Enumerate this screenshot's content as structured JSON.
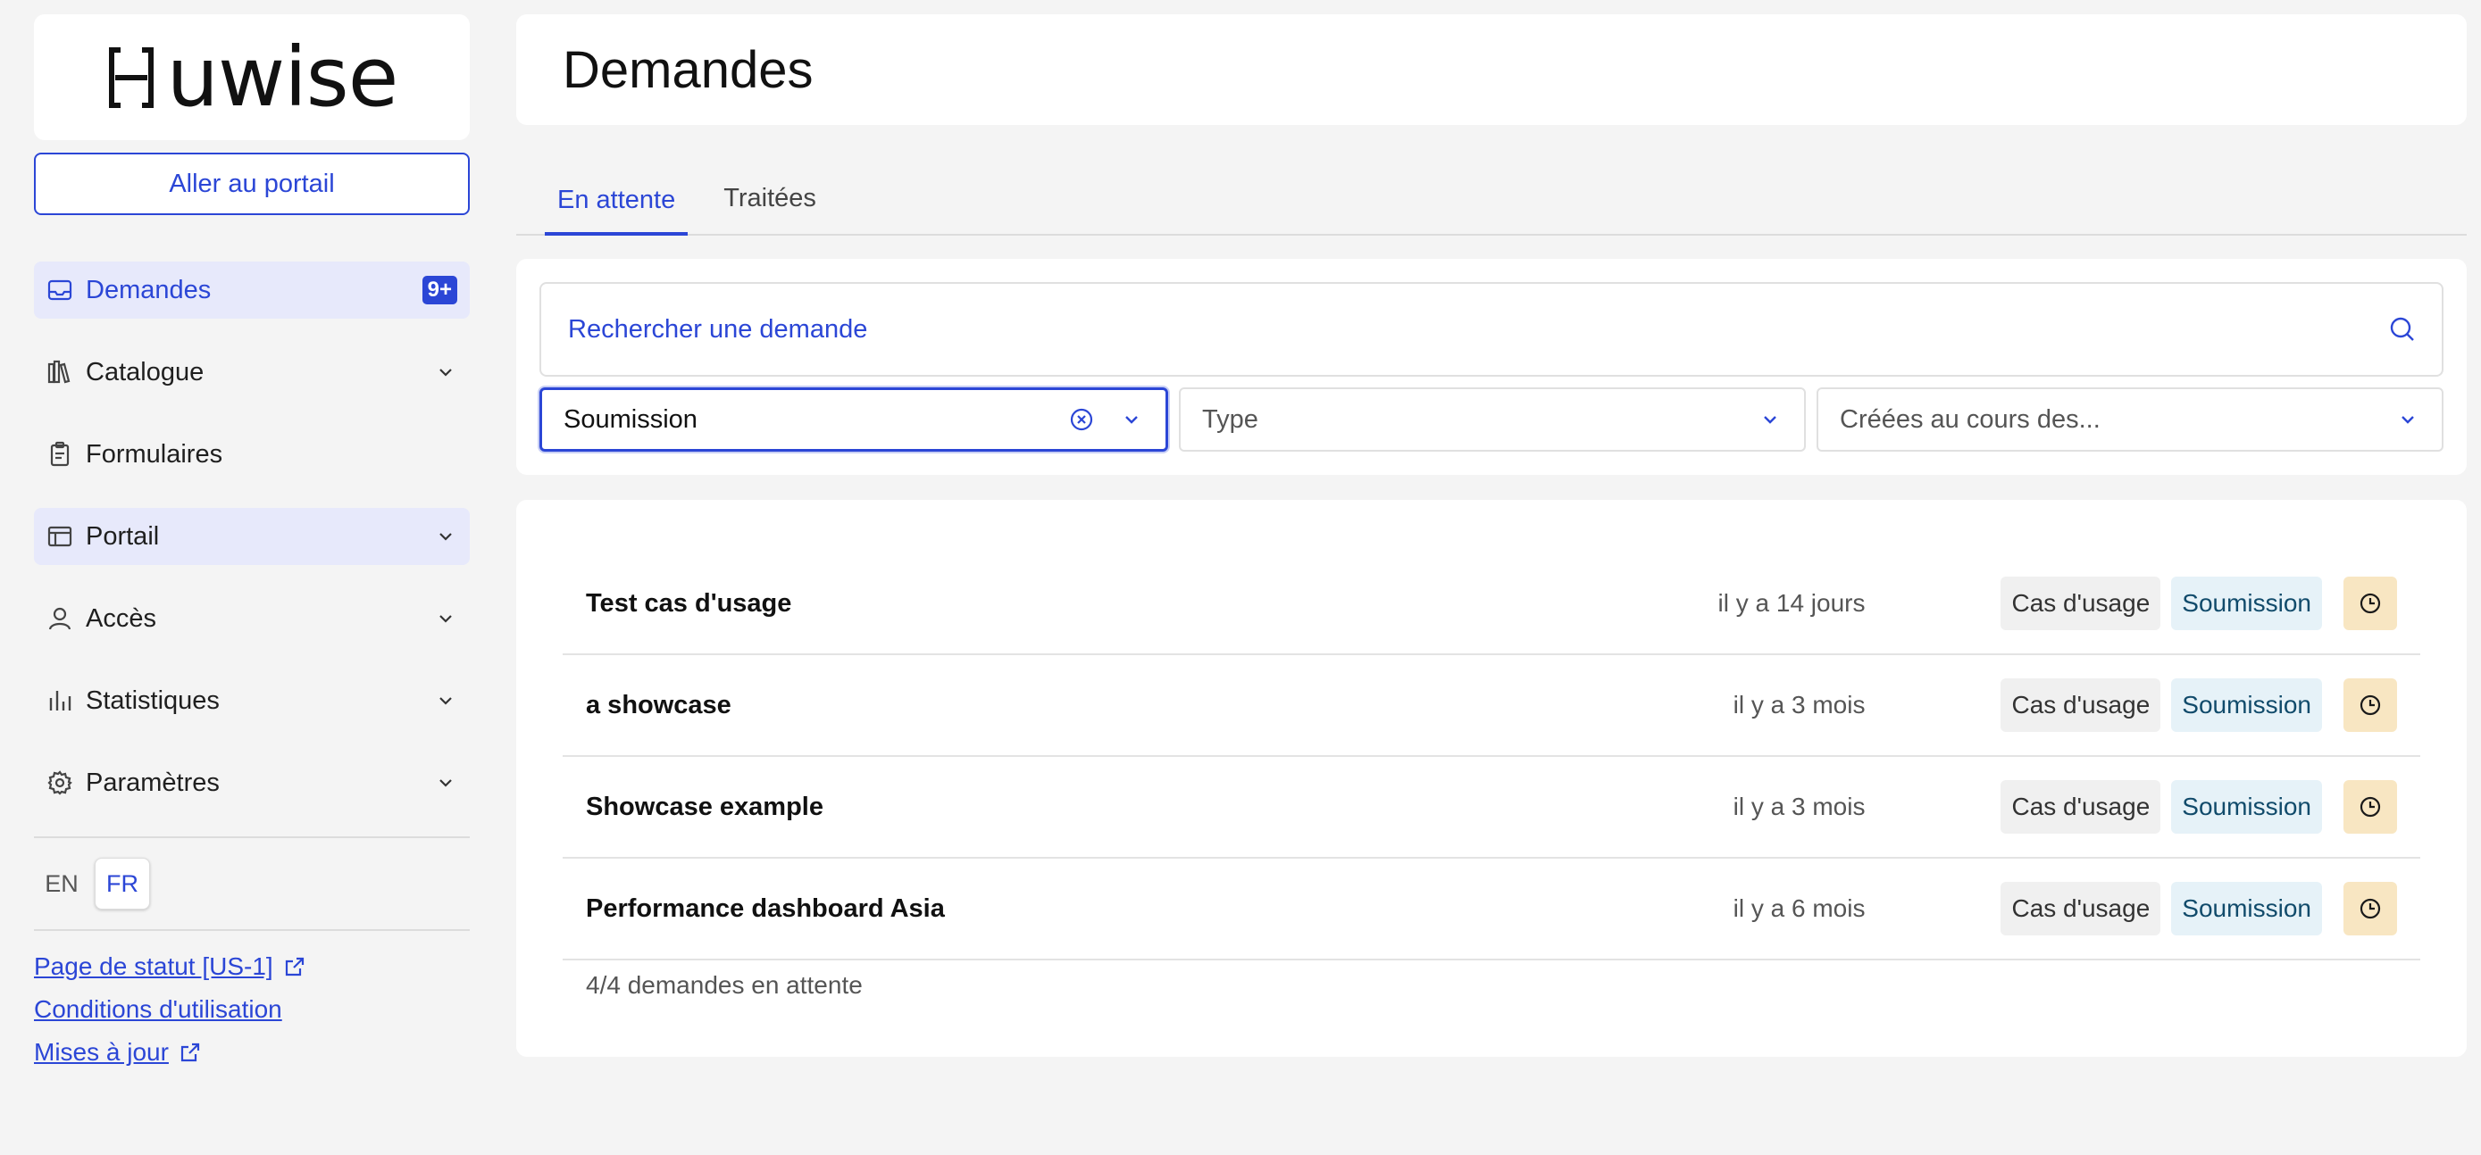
{
  "brand": {
    "logo_text": "uwise"
  },
  "sidebar": {
    "portal_button": "Aller au portail",
    "items": [
      {
        "label": "Demandes",
        "icon": "inbox-icon",
        "badge": "9+",
        "active": true
      },
      {
        "label": "Catalogue",
        "icon": "books-icon",
        "expandable": true
      },
      {
        "label": "Formulaires",
        "icon": "clipboard-icon"
      },
      {
        "label": "Portail",
        "icon": "browser-window-icon",
        "expandable": true,
        "highlighted": true
      },
      {
        "label": "Accès",
        "icon": "user-icon",
        "expandable": true
      },
      {
        "label": "Statistiques",
        "icon": "bar-chart-icon",
        "expandable": true
      },
      {
        "label": "Paramètres",
        "icon": "gear-icon",
        "expandable": true
      }
    ],
    "languages": [
      {
        "code": "EN",
        "active": false
      },
      {
        "code": "FR",
        "active": true
      }
    ],
    "footer_links": [
      {
        "label": "Page de statut [US-1]",
        "external": true
      },
      {
        "label": "Conditions d'utilisation",
        "external": false
      },
      {
        "label": "Mises à jour",
        "external": true
      }
    ]
  },
  "main": {
    "title": "Demandes",
    "tabs": [
      {
        "label": "En attente",
        "active": true
      },
      {
        "label": "Traitées",
        "active": false
      }
    ],
    "search": {
      "placeholder": "Rechercher une demande"
    },
    "filters": {
      "status_value": "Soumission",
      "type_placeholder": "Type",
      "date_placeholder": "Créées au cours des..."
    },
    "requests": [
      {
        "title": "Test cas d'usage",
        "date": "il y a 14 jours",
        "type": "Cas d'usage",
        "status": "Soumission"
      },
      {
        "title": "a showcase",
        "date": "il y a 3 mois",
        "type": "Cas d'usage",
        "status": "Soumission"
      },
      {
        "title": "Showcase example",
        "date": "il y a 3 mois",
        "type": "Cas d'usage",
        "status": "Soumission"
      },
      {
        "title": "Performance dashboard Asia",
        "date": "il y a 6 mois",
        "type": "Cas d'usage",
        "status": "Soumission"
      }
    ],
    "count_text": "4/4 demandes en attente"
  },
  "colors": {
    "accent": "#2b46d6",
    "status_chip_bg": "#e6f2f8",
    "pending_clock_bg": "#f8e6c2"
  }
}
